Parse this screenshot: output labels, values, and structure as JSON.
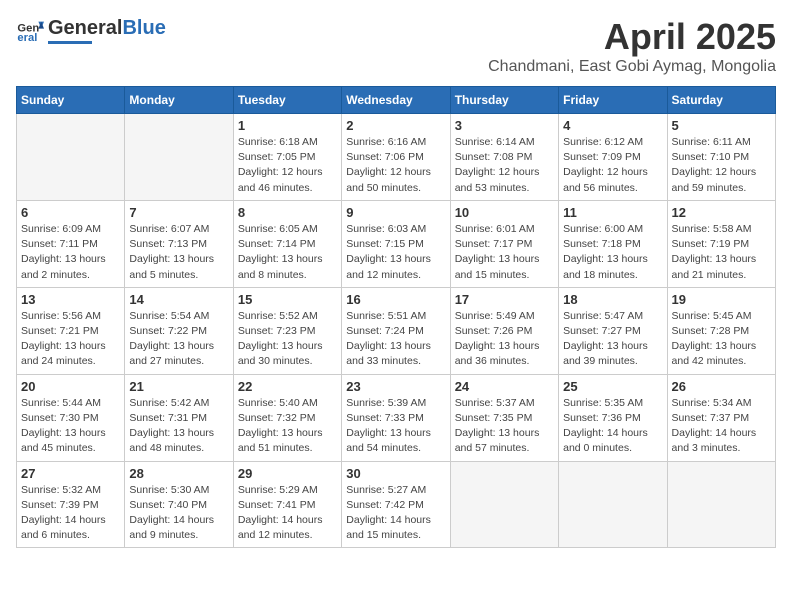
{
  "header": {
    "logo_general": "General",
    "logo_blue": "Blue",
    "title": "April 2025",
    "subtitle": "Chandmani, East Gobi Aymag, Mongolia"
  },
  "weekdays": [
    "Sunday",
    "Monday",
    "Tuesday",
    "Wednesday",
    "Thursday",
    "Friday",
    "Saturday"
  ],
  "weeks": [
    [
      {
        "day": "",
        "detail": ""
      },
      {
        "day": "",
        "detail": ""
      },
      {
        "day": "1",
        "detail": "Sunrise: 6:18 AM\nSunset: 7:05 PM\nDaylight: 12 hours\nand 46 minutes."
      },
      {
        "day": "2",
        "detail": "Sunrise: 6:16 AM\nSunset: 7:06 PM\nDaylight: 12 hours\nand 50 minutes."
      },
      {
        "day": "3",
        "detail": "Sunrise: 6:14 AM\nSunset: 7:08 PM\nDaylight: 12 hours\nand 53 minutes."
      },
      {
        "day": "4",
        "detail": "Sunrise: 6:12 AM\nSunset: 7:09 PM\nDaylight: 12 hours\nand 56 minutes."
      },
      {
        "day": "5",
        "detail": "Sunrise: 6:11 AM\nSunset: 7:10 PM\nDaylight: 12 hours\nand 59 minutes."
      }
    ],
    [
      {
        "day": "6",
        "detail": "Sunrise: 6:09 AM\nSunset: 7:11 PM\nDaylight: 13 hours\nand 2 minutes."
      },
      {
        "day": "7",
        "detail": "Sunrise: 6:07 AM\nSunset: 7:13 PM\nDaylight: 13 hours\nand 5 minutes."
      },
      {
        "day": "8",
        "detail": "Sunrise: 6:05 AM\nSunset: 7:14 PM\nDaylight: 13 hours\nand 8 minutes."
      },
      {
        "day": "9",
        "detail": "Sunrise: 6:03 AM\nSunset: 7:15 PM\nDaylight: 13 hours\nand 12 minutes."
      },
      {
        "day": "10",
        "detail": "Sunrise: 6:01 AM\nSunset: 7:17 PM\nDaylight: 13 hours\nand 15 minutes."
      },
      {
        "day": "11",
        "detail": "Sunrise: 6:00 AM\nSunset: 7:18 PM\nDaylight: 13 hours\nand 18 minutes."
      },
      {
        "day": "12",
        "detail": "Sunrise: 5:58 AM\nSunset: 7:19 PM\nDaylight: 13 hours\nand 21 minutes."
      }
    ],
    [
      {
        "day": "13",
        "detail": "Sunrise: 5:56 AM\nSunset: 7:21 PM\nDaylight: 13 hours\nand 24 minutes."
      },
      {
        "day": "14",
        "detail": "Sunrise: 5:54 AM\nSunset: 7:22 PM\nDaylight: 13 hours\nand 27 minutes."
      },
      {
        "day": "15",
        "detail": "Sunrise: 5:52 AM\nSunset: 7:23 PM\nDaylight: 13 hours\nand 30 minutes."
      },
      {
        "day": "16",
        "detail": "Sunrise: 5:51 AM\nSunset: 7:24 PM\nDaylight: 13 hours\nand 33 minutes."
      },
      {
        "day": "17",
        "detail": "Sunrise: 5:49 AM\nSunset: 7:26 PM\nDaylight: 13 hours\nand 36 minutes."
      },
      {
        "day": "18",
        "detail": "Sunrise: 5:47 AM\nSunset: 7:27 PM\nDaylight: 13 hours\nand 39 minutes."
      },
      {
        "day": "19",
        "detail": "Sunrise: 5:45 AM\nSunset: 7:28 PM\nDaylight: 13 hours\nand 42 minutes."
      }
    ],
    [
      {
        "day": "20",
        "detail": "Sunrise: 5:44 AM\nSunset: 7:30 PM\nDaylight: 13 hours\nand 45 minutes."
      },
      {
        "day": "21",
        "detail": "Sunrise: 5:42 AM\nSunset: 7:31 PM\nDaylight: 13 hours\nand 48 minutes."
      },
      {
        "day": "22",
        "detail": "Sunrise: 5:40 AM\nSunset: 7:32 PM\nDaylight: 13 hours\nand 51 minutes."
      },
      {
        "day": "23",
        "detail": "Sunrise: 5:39 AM\nSunset: 7:33 PM\nDaylight: 13 hours\nand 54 minutes."
      },
      {
        "day": "24",
        "detail": "Sunrise: 5:37 AM\nSunset: 7:35 PM\nDaylight: 13 hours\nand 57 minutes."
      },
      {
        "day": "25",
        "detail": "Sunrise: 5:35 AM\nSunset: 7:36 PM\nDaylight: 14 hours\nand 0 minutes."
      },
      {
        "day": "26",
        "detail": "Sunrise: 5:34 AM\nSunset: 7:37 PM\nDaylight: 14 hours\nand 3 minutes."
      }
    ],
    [
      {
        "day": "27",
        "detail": "Sunrise: 5:32 AM\nSunset: 7:39 PM\nDaylight: 14 hours\nand 6 minutes."
      },
      {
        "day": "28",
        "detail": "Sunrise: 5:30 AM\nSunset: 7:40 PM\nDaylight: 14 hours\nand 9 minutes."
      },
      {
        "day": "29",
        "detail": "Sunrise: 5:29 AM\nSunset: 7:41 PM\nDaylight: 14 hours\nand 12 minutes."
      },
      {
        "day": "30",
        "detail": "Sunrise: 5:27 AM\nSunset: 7:42 PM\nDaylight: 14 hours\nand 15 minutes."
      },
      {
        "day": "",
        "detail": ""
      },
      {
        "day": "",
        "detail": ""
      },
      {
        "day": "",
        "detail": ""
      }
    ]
  ]
}
